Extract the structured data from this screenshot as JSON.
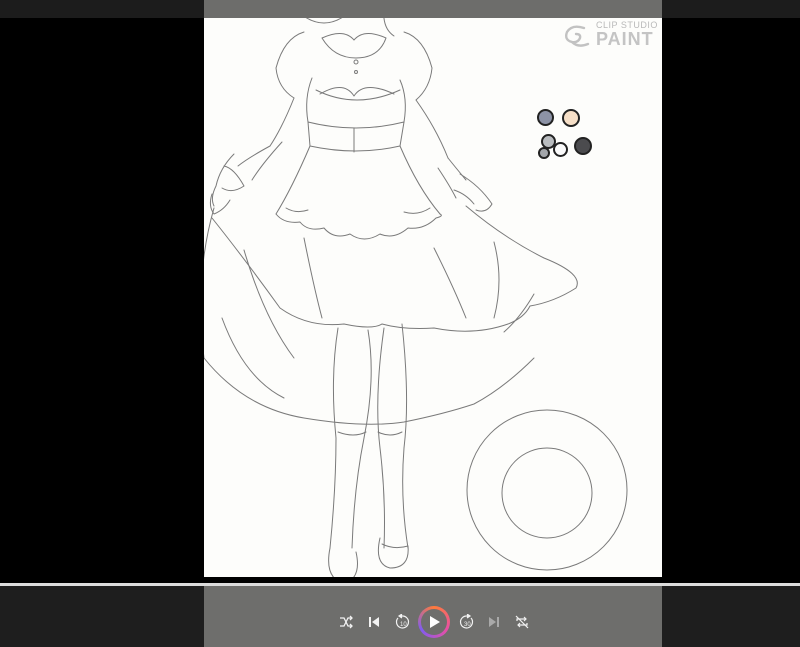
{
  "watermark": {
    "top_text": "CLIP STUDIO",
    "main_text": "PAINT"
  },
  "palette": {
    "swatches": [
      {
        "name": "slate-gray",
        "color": "#8d93a6"
      },
      {
        "name": "peach",
        "color": "#f6dfc7"
      },
      {
        "name": "light-gray",
        "color": "#b9bcbf"
      },
      {
        "name": "white",
        "color": "#fbfbfb"
      },
      {
        "name": "dark-gray",
        "color": "#4b4b4e"
      },
      {
        "name": "small-gray",
        "color": "#a3a6aa"
      }
    ]
  },
  "player": {
    "progress_fraction": 1.0,
    "rewind_seconds": "10",
    "forward_seconds": "30",
    "buttons": [
      "shuffle-icon",
      "skip-previous-icon",
      "rewind-10-icon",
      "play-icon",
      "forward-30-icon",
      "skip-next-icon",
      "repeat-off-icon"
    ]
  },
  "colors": {
    "accent_gradient": [
      "#ff7b3a",
      "#e84fa6",
      "#7f5cf0"
    ],
    "canvas_bg": "#fdfdfb"
  }
}
